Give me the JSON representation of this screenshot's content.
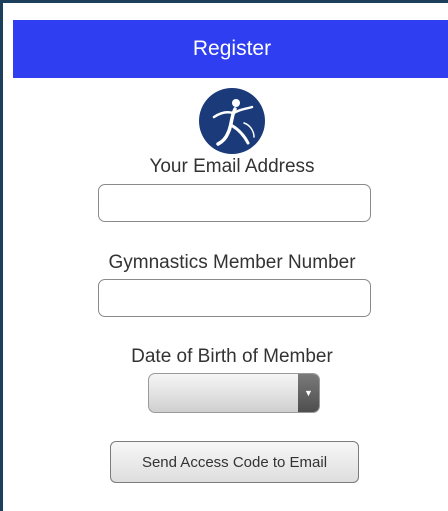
{
  "header": {
    "title": "Register"
  },
  "logo": {
    "icon": "gymnast-logo-icon",
    "bg_color": "#1a3a7a"
  },
  "form": {
    "email_label": "Your Email Address",
    "email_value": "",
    "member_label": "Gymnastics Member Number",
    "member_value": "",
    "dob_label": "Date of Birth of Member",
    "dob_value": "",
    "dob_arrow_icon": "chevron-down-icon",
    "submit_label": "Send Access Code to Email"
  },
  "colors": {
    "header": "#2f3ef0",
    "frame_border": "#1c3f5c"
  }
}
